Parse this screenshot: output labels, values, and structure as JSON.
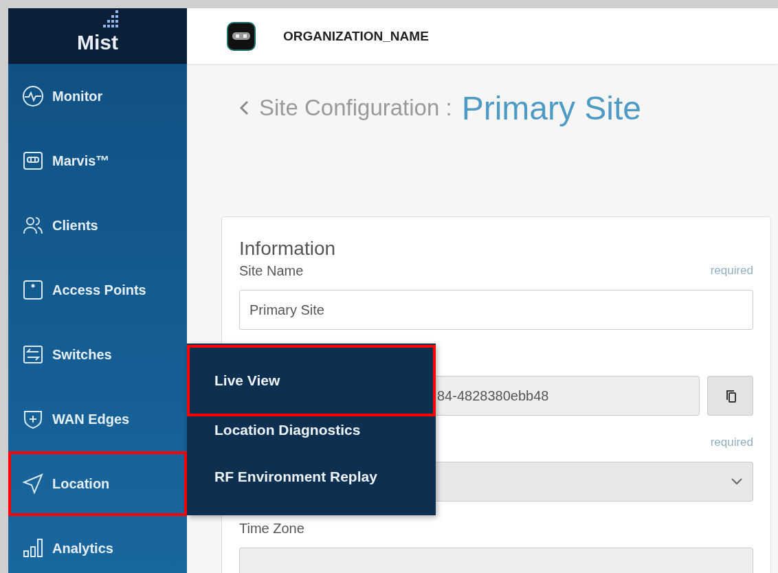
{
  "logo": {
    "text": "Mist"
  },
  "header": {
    "org_name": "ORGANIZATION_NAME"
  },
  "sidebar": {
    "items": [
      {
        "label": "Monitor",
        "kind": "monitor",
        "highlighted": false
      },
      {
        "label": "Marvis™",
        "kind": "marvis",
        "highlighted": false
      },
      {
        "label": "Clients",
        "kind": "clients",
        "highlighted": false
      },
      {
        "label": "Access Points",
        "kind": "ap",
        "highlighted": false
      },
      {
        "label": "Switches",
        "kind": "switches",
        "highlighted": false
      },
      {
        "label": "WAN Edges",
        "kind": "wan",
        "highlighted": false
      },
      {
        "label": "Location",
        "kind": "location",
        "highlighted": true
      },
      {
        "label": "Analytics",
        "kind": "analytics",
        "highlighted": false
      }
    ]
  },
  "page": {
    "title_prefix": "Site Configuration :",
    "title": "Primary Site"
  },
  "card": {
    "title": "Information",
    "fields": [
      {
        "kind": "text",
        "label": "Site Name",
        "hint": "required",
        "value": "Primary Site"
      },
      {
        "kind": "copy",
        "value": "84-4828380ebb48"
      },
      {
        "kind": "select",
        "hint": "required"
      },
      {
        "kind": "text",
        "label": "Time Zone"
      }
    ]
  },
  "flyout": {
    "items": [
      {
        "label": "Live View",
        "highlighted": true
      },
      {
        "label": "Location Diagnostics",
        "highlighted": false
      },
      {
        "label": "RF Environment Replay",
        "highlighted": false
      }
    ]
  }
}
